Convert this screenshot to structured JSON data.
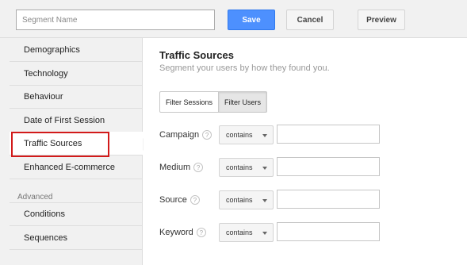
{
  "header": {
    "segment_name_placeholder": "Segment Name",
    "save_label": "Save",
    "cancel_label": "Cancel",
    "preview_label": "Preview"
  },
  "sidebar": {
    "items": [
      {
        "label": "Demographics"
      },
      {
        "label": "Technology"
      },
      {
        "label": "Behaviour"
      },
      {
        "label": "Date of First Session"
      },
      {
        "label": "Traffic Sources"
      },
      {
        "label": "Enhanced E-commerce"
      }
    ],
    "active_item": "Traffic Sources",
    "advanced_heading": "Advanced",
    "advanced_items": [
      {
        "label": "Conditions"
      },
      {
        "label": "Sequences"
      }
    ]
  },
  "main": {
    "title": "Traffic Sources",
    "subtitle": "Segment your users by how they found you.",
    "filter_buttons": [
      {
        "label": "Filter Sessions"
      },
      {
        "label": "Filter Users"
      }
    ],
    "selected_filter": "Filter Users",
    "help_glyph": "?",
    "rows": [
      {
        "label": "Campaign",
        "operator": "contains",
        "value": ""
      },
      {
        "label": "Medium",
        "operator": "contains",
        "value": ""
      },
      {
        "label": "Source",
        "operator": "contains",
        "value": ""
      },
      {
        "label": "Keyword",
        "operator": "contains",
        "value": ""
      }
    ]
  },
  "colors": {
    "primary_button": "#4d90fe",
    "highlight_border": "#d21a1a",
    "sidebar_bg": "#f1f1f1"
  },
  "icons": {
    "help": "help-icon",
    "dropdown": "chevron-down-icon"
  }
}
